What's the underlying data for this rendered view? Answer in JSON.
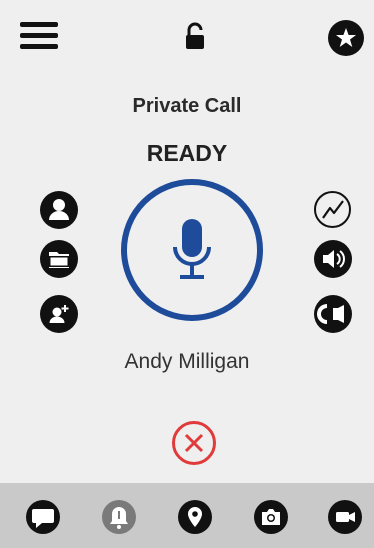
{
  "call": {
    "type_label": "Private Call",
    "status": "READY",
    "caller_name": "Andy Milligan"
  },
  "colors": {
    "accent": "#1e4c9a",
    "end_call": "#e03a3a",
    "icon": "#111111",
    "disabled": "#7a7a7a"
  },
  "icons": {
    "top": [
      "menu-icon",
      "unlock-icon",
      "star-icon"
    ],
    "left": [
      "contact-icon",
      "folder-icon",
      "add-contact-icon"
    ],
    "right": [
      "signal-icon",
      "speaker-icon",
      "earpiece-icon"
    ],
    "bottom": [
      "message-icon",
      "alert-icon",
      "location-icon",
      "camera-icon",
      "video-icon"
    ]
  }
}
